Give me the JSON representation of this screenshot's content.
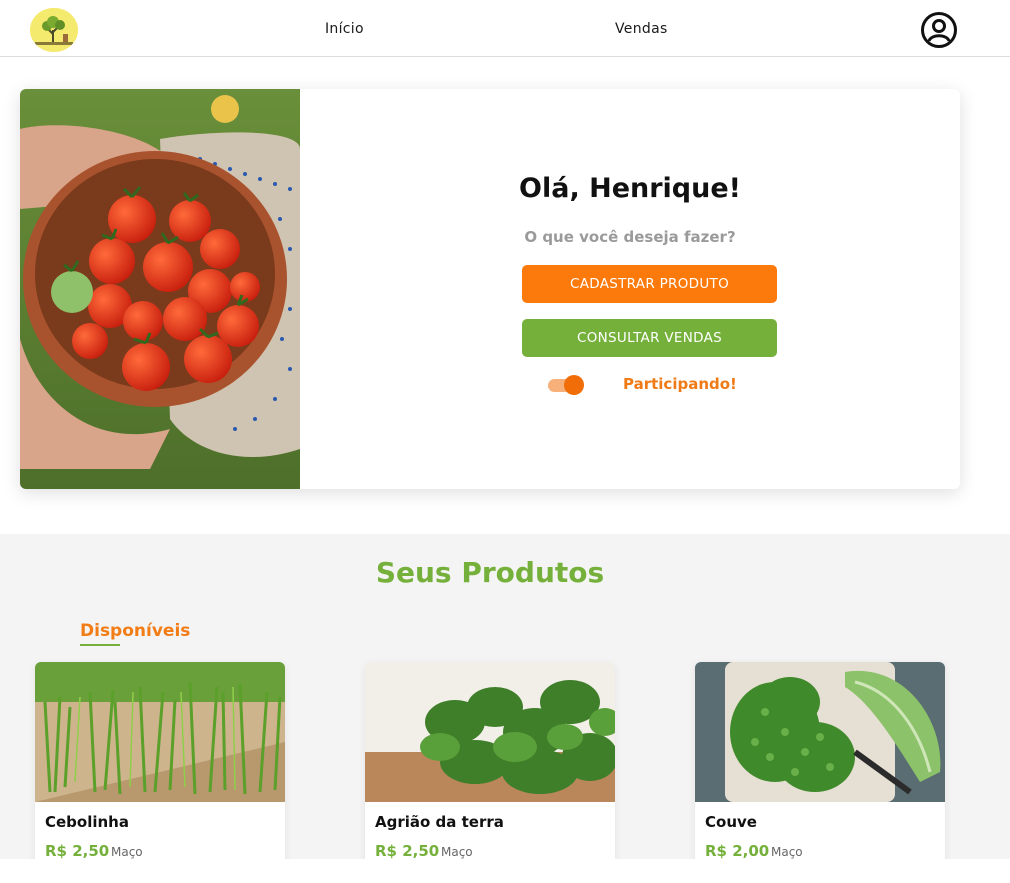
{
  "header": {
    "logo_icon": "farm-tree-logo-icon",
    "nav": [
      {
        "label": "Início"
      },
      {
        "label": "Vendas"
      }
    ],
    "user_icon": "user-circle-icon"
  },
  "hero": {
    "image": "tomatoes-bowl-photo",
    "greeting": "Olá, Henrique!",
    "question": "O que você deseja fazer?",
    "primary_button": "CADASTRAR PRODUTO",
    "secondary_button": "CONSULTAR VENDAS",
    "toggle_label": "Participando!",
    "toggle_on": true
  },
  "products": {
    "title": "Seus Produtos",
    "tab": "Disponíveis",
    "items": [
      {
        "name": "Cebolinha",
        "price": "R$ 2,50",
        "unit": "Maço",
        "image": "green-onion-field-photo"
      },
      {
        "name": "Agrião da terra",
        "price": "R$ 2,50",
        "unit": "Maço",
        "image": "watercress-photo"
      },
      {
        "name": "Couve",
        "price": "R$ 2,00",
        "unit": "Maço",
        "image": "chopped-kale-photo"
      }
    ]
  },
  "colors": {
    "orange": "#fc7a0b",
    "green": "#74b03a",
    "logo_yellow": "#f4ea6d"
  }
}
